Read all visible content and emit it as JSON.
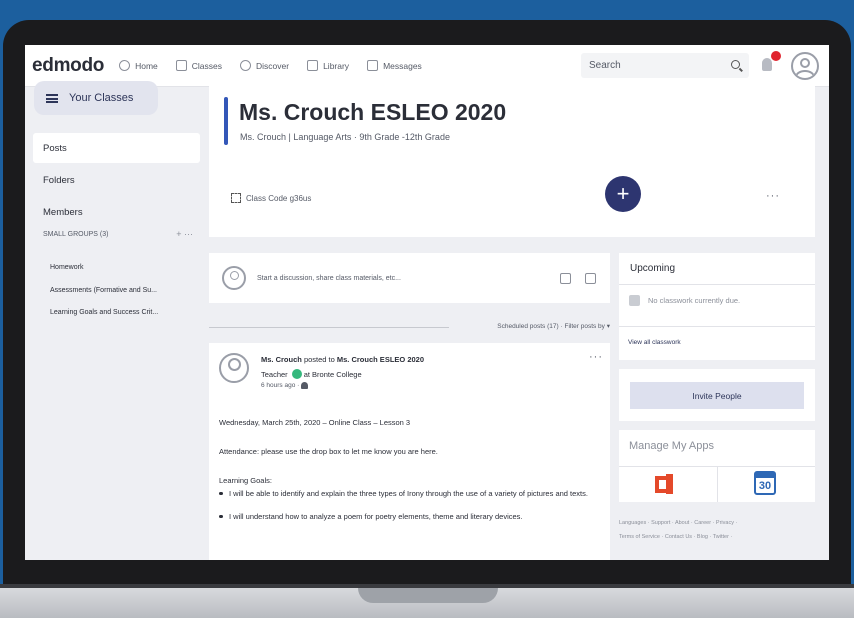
{
  "nav": {
    "logo": "edmodo",
    "items": [
      {
        "label": "Home",
        "icon": "home-icon"
      },
      {
        "label": "Classes",
        "icon": "classes-icon"
      },
      {
        "label": "Discover",
        "icon": "discover-icon"
      },
      {
        "label": "Library",
        "icon": "library-icon"
      },
      {
        "label": "Messages",
        "icon": "messages-icon"
      }
    ],
    "search_placeholder": "Search"
  },
  "sidebar": {
    "your_classes": "Your Classes",
    "items": [
      {
        "label": "Posts"
      },
      {
        "label": "Folders"
      },
      {
        "label": "Members"
      }
    ],
    "small_groups": "SMALL GROUPS (3)",
    "small_groups_actions": "+ ···",
    "groups": [
      "Homework",
      "Assessments (Formative and Su...",
      "Learning Goals and Success Crit..."
    ]
  },
  "class_header": {
    "title": "Ms. Crouch ESLEO 2020",
    "subtitle": "Ms. Crouch | Language Arts · 9th Grade -12th Grade",
    "class_code": "Class Code g36us",
    "more": "···",
    "add": "+"
  },
  "composer": {
    "placeholder": "Start a discussion, share class materials, etc..."
  },
  "feed": {
    "scheduled": "Scheduled posts (17) ·",
    "filter": "Filter posts by ▾"
  },
  "post": {
    "author": "Ms. Crouch",
    "posted_to": "posted to",
    "class_name": "Ms. Crouch ESLEO 2020",
    "role": "Teacher",
    "school": "at Bronte College",
    "time": "6 hours ago ·",
    "more": "···",
    "lines": [
      "Wednesday, March 25th, 2020 – Online Class – Lesson 3",
      "Attendance: please use the drop box to let me know you are here.",
      "Learning Goals:"
    ],
    "bullets": [
      "I will be able to identify and explain the three types of Irony through the use of a variety of pictures and texts.",
      "I will understand how to analyze a poem for poetry elements, theme and literary devices."
    ]
  },
  "upcoming": {
    "title": "Upcoming",
    "empty": "No classwork currently due.",
    "view_all": "View all classwork"
  },
  "invite": {
    "label": "Invite People"
  },
  "apps": {
    "title": "Manage My Apps",
    "calendar_day": "30"
  },
  "footer": {
    "line1": "Languages · Support · About · Career · Privacy ·",
    "line2": "Terms of Service · Contact Us · Blog · Twitter ·"
  },
  "colors": {
    "page_bg": "#1c5f9e",
    "accent": "#3357b8",
    "plus_button": "#2d3570",
    "badge": "#e0242e",
    "verified": "#35b87d"
  }
}
